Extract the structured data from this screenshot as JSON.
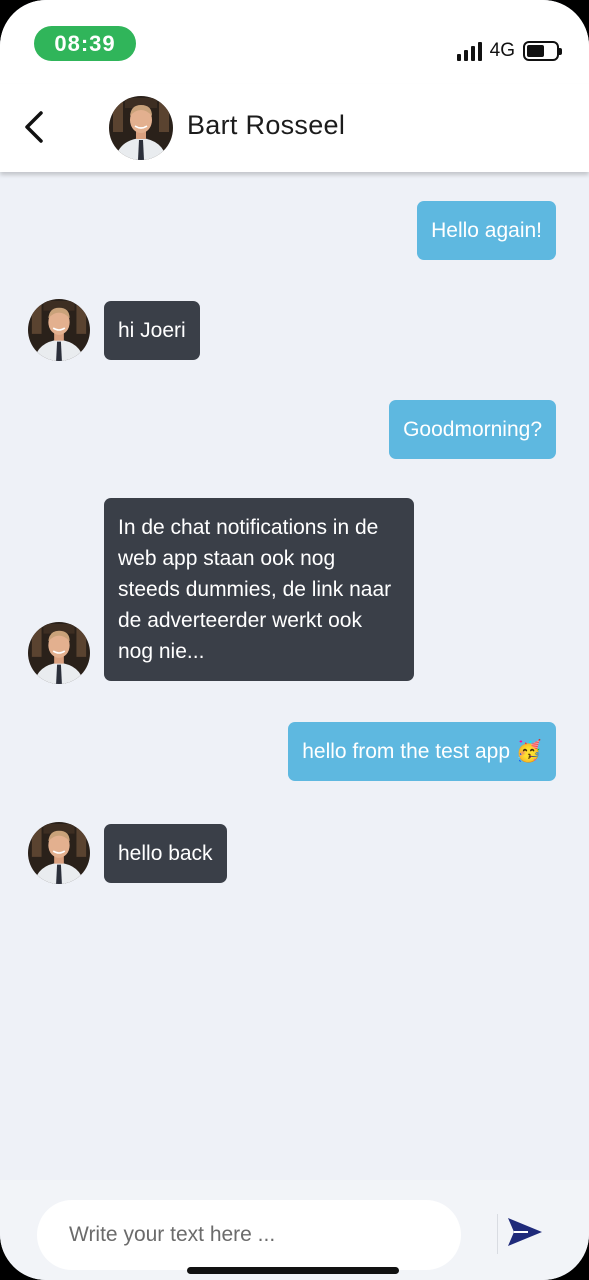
{
  "status_bar": {
    "time": "08:39",
    "network": "4G",
    "battery_level": 0.6
  },
  "header": {
    "back_icon": "chevron-left-icon",
    "contact_name": "Bart Rosseel"
  },
  "messages": [
    {
      "direction": "outgoing",
      "text": "Hello again!"
    },
    {
      "direction": "incoming",
      "text": "hi Joeri"
    },
    {
      "direction": "outgoing",
      "text": "Goodmorning?"
    },
    {
      "direction": "incoming",
      "text": "In de chat notifications in de web app staan ook nog steeds dummies, de link naar de adverteerder werkt ook nog nie..."
    },
    {
      "direction": "outgoing",
      "text": "hello from the test app 🥳"
    },
    {
      "direction": "incoming",
      "text": "hello back"
    }
  ],
  "composer": {
    "placeholder": "Write your text here ...",
    "send_icon": "send-icon"
  },
  "colors": {
    "outgoing_bubble": "#5eb8e0",
    "incoming_bubble": "#3a3f48",
    "background": "#eef1f7",
    "time_pill": "#30b55a",
    "send_icon": "#1f2a7a"
  }
}
